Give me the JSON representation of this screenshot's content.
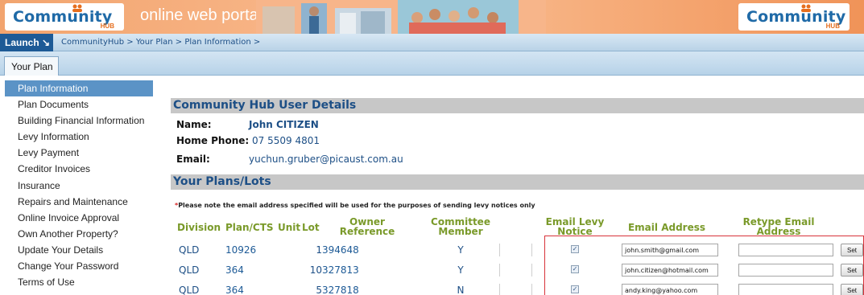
{
  "header": {
    "logo_text": "Community",
    "logo_sub": "HUB",
    "portal_title": "online web portal"
  },
  "nav": {
    "launch_label": "Launch ↘",
    "breadcrumb": "CommunityHub > Your Plan > Plan Information >"
  },
  "tabs": [
    {
      "label": "Your Plan"
    }
  ],
  "sidebar": {
    "items": [
      {
        "label": "Plan Information"
      },
      {
        "label": "Plan Documents"
      },
      {
        "label": "Building Financial Information"
      },
      {
        "label": "Levy Information"
      },
      {
        "label": "Levy Payment"
      },
      {
        "label": "Creditor Invoices"
      },
      {
        "label": "Insurance"
      },
      {
        "label": "Repairs and Maintenance"
      },
      {
        "label": "Online Invoice Approval"
      },
      {
        "label": "Own Another Property?"
      },
      {
        "label": "Update Your Details"
      },
      {
        "label": "Change Your Password"
      },
      {
        "label": "Terms of Use"
      }
    ],
    "active_index": 0
  },
  "user_details": {
    "heading": "Community Hub User Details",
    "name_label": "Name:",
    "name_value": "John CITIZEN",
    "phone_label": "Home Phone:",
    "phone_value": "07 5509 4801",
    "email_label": "Email:",
    "email_value": "yuchun.gruber@picaust.com.au"
  },
  "plans": {
    "heading": "Your Plans/Lots",
    "note_star": "*",
    "note": "Please note the email address specified will be used for the purposes of sending levy notices only",
    "columns": {
      "division": "Division",
      "plan": "Plan/CTS",
      "unit": "Unit",
      "lot": "Lot",
      "owner_ref": "Owner Reference",
      "committee": "Committee Member",
      "email_levy": "Email Levy Notice",
      "email_address": "Email Address",
      "retype_email": "Retype Email Address"
    },
    "set_label": "Set",
    "rows": [
      {
        "division": "QLD",
        "plan": "10926",
        "lot": "1",
        "owner_ref": "394648",
        "committee": "Y",
        "email_levy": true,
        "email": "john.smith@gmail.com",
        "retype": ""
      },
      {
        "division": "QLD",
        "plan": "364",
        "lot": "10",
        "owner_ref": "327813",
        "committee": "Y",
        "email_levy": true,
        "email": "john.citizen@hotmail.com",
        "retype": ""
      },
      {
        "division": "QLD",
        "plan": "364",
        "lot": "5",
        "owner_ref": "327818",
        "committee": "N",
        "email_levy": true,
        "email": "andy.king@yahoo.com",
        "retype": ""
      }
    ]
  },
  "colors": {
    "header_orange": "#f5a874",
    "brand_blue": "#1d5a96",
    "active_nav": "#5b93c6",
    "column_green": "#7a9a2a",
    "highlight_red": "#d8333a"
  }
}
